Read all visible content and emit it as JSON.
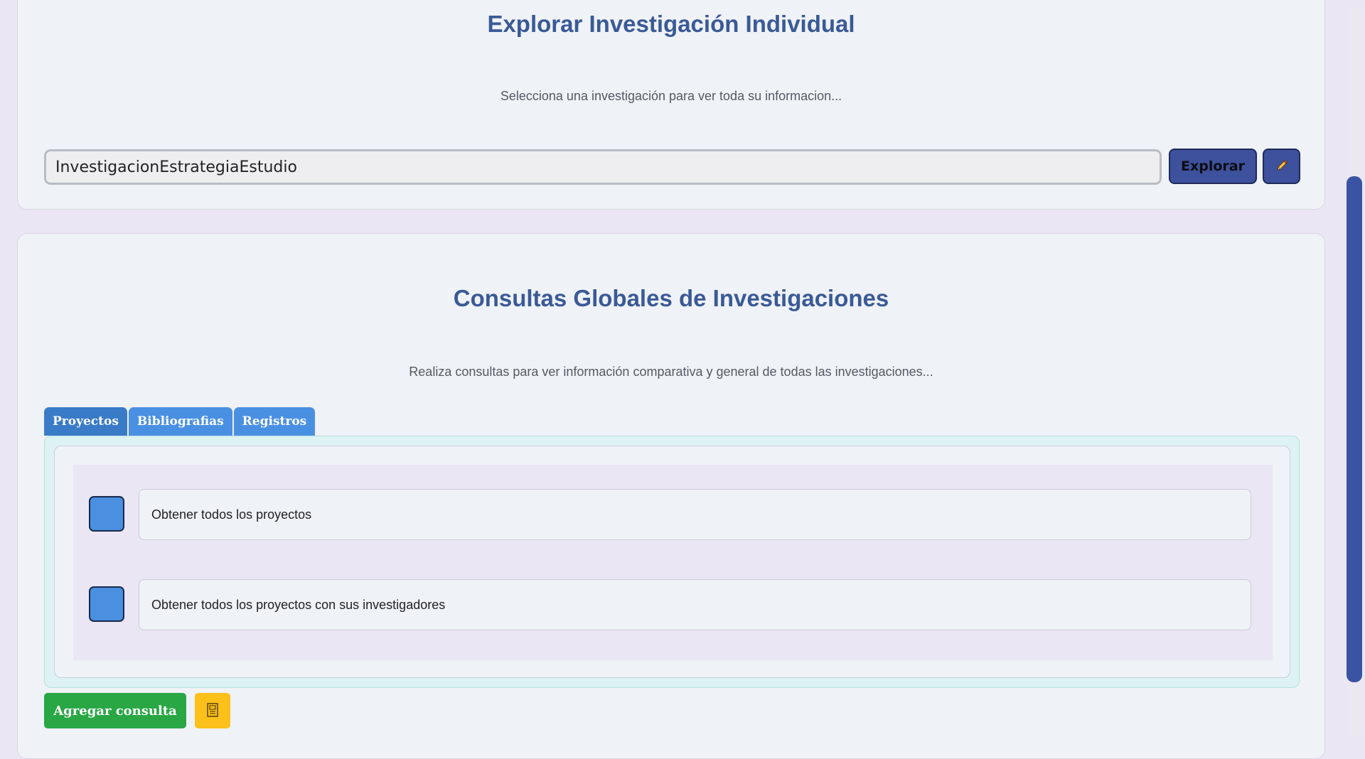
{
  "explore": {
    "title": "Explorar Investigación Individual",
    "subtitle": "Selecciona una investigación para ver toda su informacion...",
    "search_value": "InvestigacionEstrategiaEstudio",
    "explore_label": "Explorar",
    "edit_icon": "pencil-icon"
  },
  "global": {
    "title": "Consultas Globales de Investigaciones",
    "subtitle": "Realiza consultas para ver información comparativa y general de todas las investigaciones...",
    "tabs": [
      {
        "label": "Proyectos",
        "active": true
      },
      {
        "label": "Bibliografias",
        "active": false
      },
      {
        "label": "Registros",
        "active": false
      }
    ],
    "queries": [
      {
        "label": "Obtener todos los proyectos"
      },
      {
        "label": "Obtener todos los proyectos con sus investigadores"
      }
    ],
    "add_query_label": "Agregar consulta",
    "export_icon": "document-icon"
  },
  "colors": {
    "title": "#3a5a96",
    "primary_button": "#3d519c",
    "tab": "#4a90e2",
    "tab_active": "#3a7bc8",
    "add_button": "#29a745",
    "export_button": "#fbc11a",
    "checkbox": "#4a8fe0",
    "scroll_thumb": "#3a54a3"
  }
}
